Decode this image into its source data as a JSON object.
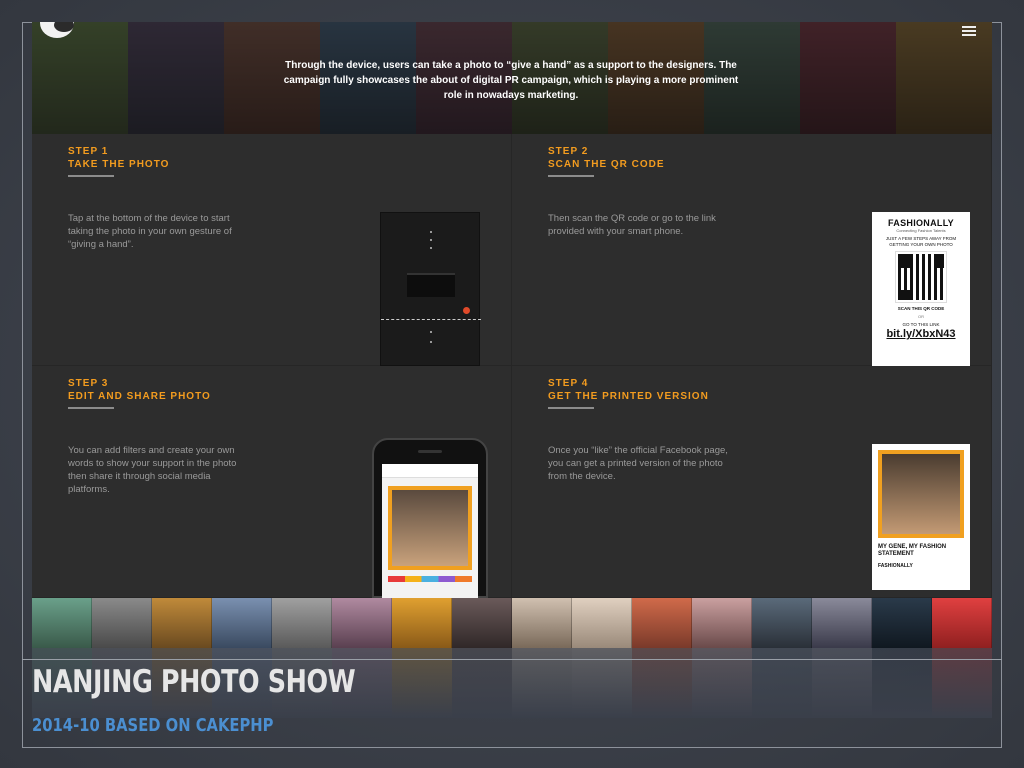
{
  "hero": {
    "description": "Through the device, users can take a photo to “give a hand” as a support to the designers. The campaign fully showcases the about of digital PR campaign, which is playing a more prominent role in nowadays marketing."
  },
  "steps": [
    {
      "number": "STEP 1",
      "title": "TAKE THE PHOTO",
      "description": "Tap at the bottom of the device to start taking the photo in your own gesture of “giving a hand”."
    },
    {
      "number": "STEP 2",
      "title": "SCAN THE QR CODE",
      "description": "Then scan the QR code or go to the link provided with your smart phone."
    },
    {
      "number": "STEP 3",
      "title": "EDIT AND SHARE PHOTO",
      "description": "You can add filters and create your own words to show your support in the photo then share it through social media platforms."
    },
    {
      "number": "STEP 4",
      "title": "GET THE PRINTED VERSION",
      "description": "Once you “like” the official Facebook page, you can get a printed version of the photo from the device."
    }
  ],
  "poster": {
    "brand": "FASHIONALLY",
    "brand_sub": "Connecting Fashion Talents",
    "instructions": "JUST A FEW STEPS AWAY FROM GETTING YOUR OWN PHOTO",
    "scan_label": "SCAN THIS QR CODE",
    "or_label": "OR",
    "goto_label": "GO TO THIS LINK",
    "link": "bit.ly/XbxN43"
  },
  "print": {
    "headline": "MY GENE, MY FASHION STATEMENT",
    "brand": "FASHIONALLY"
  },
  "slide": {
    "title": "NANJING PHOTO SHOW",
    "subtitle": "2014-10 BASED ON CAKEPHP"
  },
  "colors": {
    "accent": "#f39c1f",
    "subtitle_blue": "#4b8fd1",
    "panel_bg": "#2d2d2d"
  },
  "icons": {
    "logo": "logo-icon",
    "menu": "hamburger-menu-icon"
  }
}
